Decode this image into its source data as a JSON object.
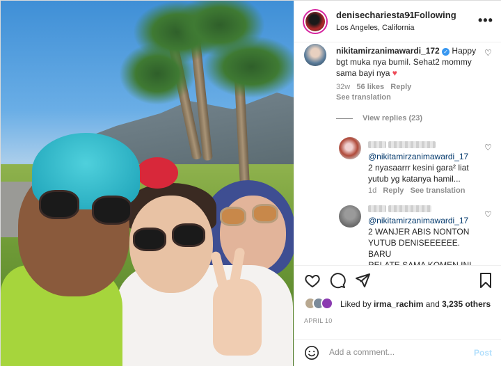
{
  "post": {
    "username": "denisechariesta91",
    "separator": "•",
    "follow_status": "Following",
    "location": "Los Angeles, California",
    "more_label": "•••"
  },
  "comments": [
    {
      "username": "nikitamirzanimawardi_172",
      "verified": true,
      "text": " Happy bgt muka nya bumil. Sehat2 mommy sama bayi nya",
      "emoji": "♥",
      "age": "32w",
      "likes": "56 likes",
      "reply_label": "Reply",
      "translate_label": "See translation",
      "view_replies": "View replies (23)"
    }
  ],
  "replies": [
    {
      "mention": "@nikitamirzanimawardi_17",
      "text_line1": "2 nyasaarrr kesini gara² liat",
      "text_line2": "yutub yg katanya hamil...",
      "age": "1d",
      "reply_label": "Reply",
      "translate_label": "See translation"
    },
    {
      "mention": "@nikitamirzanimawardi_17",
      "text_line1": "2 WANJER ABIS NONTON",
      "text_line2": "YUTUB DENISEEEEEE. BARU",
      "text_line3": "RELATE SAMA KOMEN INI"
    }
  ],
  "engagement": {
    "liked_by_prefix": "Liked by ",
    "liked_by_user": "irma_rachim",
    "liked_by_suffix": " and ",
    "others_count": "3,235 others",
    "date": "APRIL 10"
  },
  "composer": {
    "placeholder": "Add a comment...",
    "post_label": "Post"
  },
  "icons": {
    "like": "heart-outline-icon",
    "comment": "comment-bubble-icon",
    "share": "paper-plane-icon",
    "save": "bookmark-icon",
    "emoji": "smiley-icon"
  },
  "colors": {
    "verified_blue": "#3897f0",
    "heart_red": "#ed4956",
    "post_disabled": "#b2dffc",
    "muted_text": "#8e8e8e"
  }
}
